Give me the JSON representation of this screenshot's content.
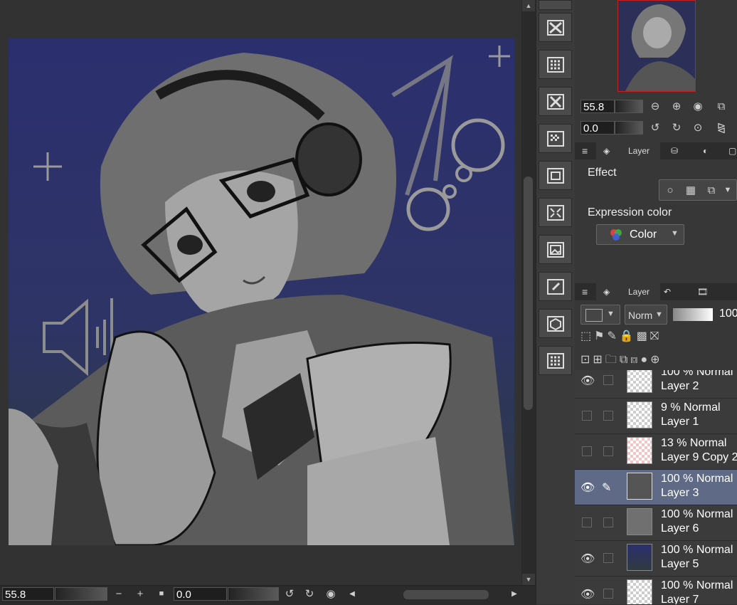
{
  "canvas": {
    "description_alt": ""
  },
  "statusbar": {
    "zoom_value": "55.8",
    "rotate_value": "0.0",
    "zoom_out_label": "−",
    "zoom_in_label": "+",
    "fit_label": "■"
  },
  "navigator": {
    "zoom_value": "55.8",
    "rotate_value": "0.0"
  },
  "property_panel": {
    "tab_label": "Layer",
    "effect_label": "Effect",
    "expression_color_label": "Expression color",
    "expression_color_value": "Color"
  },
  "layer_panel": {
    "tab_label": "Layer",
    "blend_mode": "Norm",
    "opacity": "100",
    "layers": [
      {
        "mode": "100 % Normal",
        "name": "Layer 2",
        "visible": true,
        "selected": false
      },
      {
        "mode": "9 % Normal",
        "name": "Layer 1",
        "visible": false,
        "selected": false
      },
      {
        "mode": "13 % Normal",
        "name": "Layer 9 Copy 2",
        "visible": false,
        "selected": false
      },
      {
        "mode": "100 % Normal",
        "name": "Layer 3",
        "visible": true,
        "selected": true
      },
      {
        "mode": "100 % Normal",
        "name": "Layer 6",
        "visible": false,
        "selected": false
      },
      {
        "mode": "100 % Normal",
        "name": "Layer 5",
        "visible": true,
        "selected": false
      },
      {
        "mode": "100 % Normal",
        "name": "Layer 7",
        "visible": true,
        "selected": false
      }
    ]
  },
  "colors": {
    "selected_layer": "#5e6a86",
    "canvas_bg_top": "#2c2f6e",
    "canvas_bg_bottom": "#2f3a40"
  }
}
